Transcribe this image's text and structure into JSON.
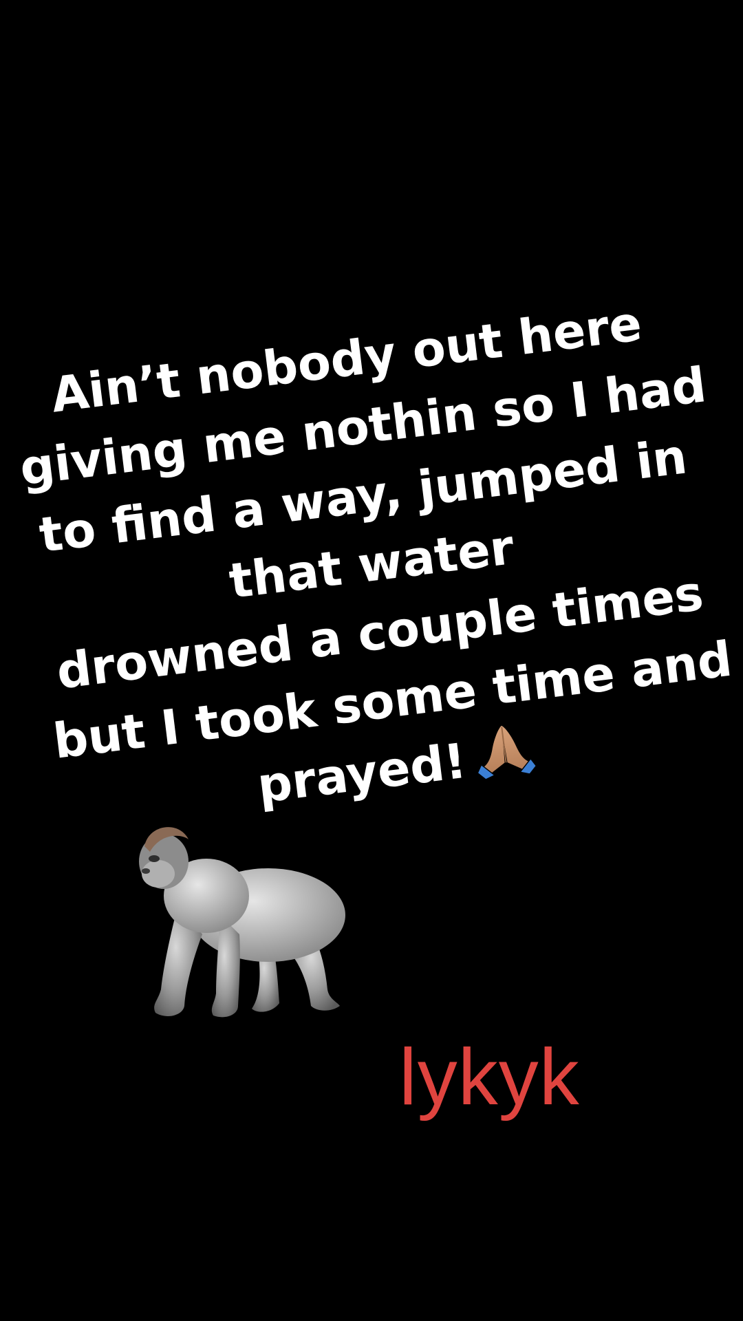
{
  "caption": {
    "lines": [
      "Ain’t nobody out here",
      "giving me nothin so I had",
      "to find a way, jumped in",
      "that water",
      "drowned a couple times",
      "but I took some time and",
      "prayed!"
    ],
    "color": "#ffffff",
    "trailing_icon": "folded-hands-emoji"
  },
  "stickers": {
    "animal_icon": "gorilla-emoji"
  },
  "tag": {
    "text": "lykyk",
    "color": "#e0443f"
  },
  "background_color": "#000000"
}
